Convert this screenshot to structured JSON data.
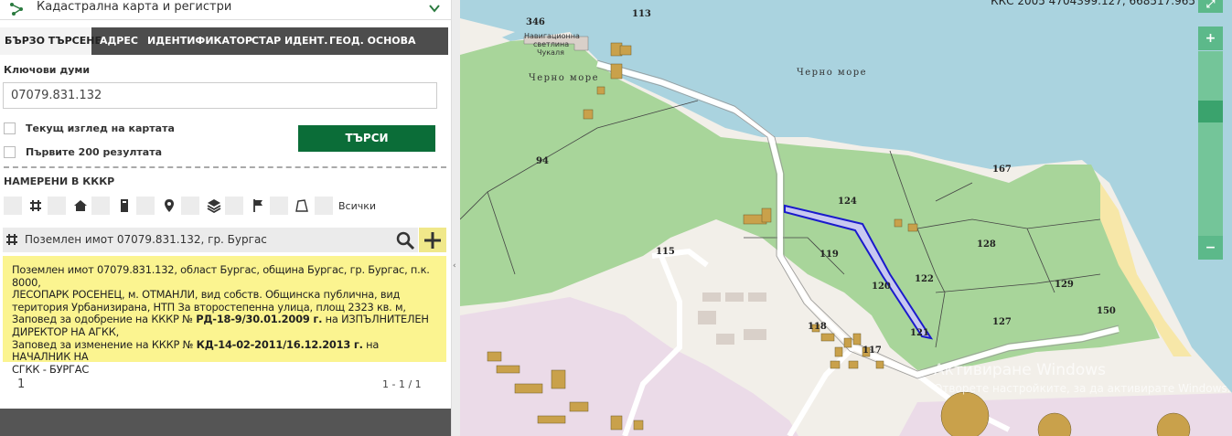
{
  "header": {
    "title": "Кадастрална карта и регистри"
  },
  "tabs": [
    "БЪРЗО ТЪРСЕНЕ",
    "АДРЕС",
    "ИДЕНТИФИКАТОР",
    "СТАР ИДЕНТ.",
    "ГЕОД. ОСНОВА"
  ],
  "search": {
    "keywords_label": "Ключови думи",
    "keywords_value": "07079.831.132",
    "current_view_label": "Текущ изглед на картата",
    "first200_label": "Първите 200 резултата",
    "search_button": "ТЪРСИ"
  },
  "found": {
    "title": "НАМЕРЕНИ В КККР",
    "all_label": "Всички",
    "filter_icons": [
      "grid-icon",
      "home-icon",
      "building-icon",
      "location-pin-icon",
      "layers-icon",
      "flag-icon",
      "polygon-icon"
    ]
  },
  "result": {
    "summary": "Поземлен имот 07079.831.132, гр. Бургас",
    "detail": {
      "line1": "Поземлен имот 07079.831.132, област Бургас, община Бургас, гр. Бургас, п.к. 8000,",
      "line2": "ЛЕСОПАРК РОСЕНЕЦ, м. ОТМАНЛИ, вид собств. Общинска публична, вид",
      "line3": "територия Урбанизирана, НТП За второстепенна улица, площ 2323 кв. м,",
      "approval_prefix": "Заповед за одобрение на КККР №",
      "approval_number": "РД-18-9/30.01.2009 г.",
      "approval_suffix": "на ИЗПЪЛНИТЕЛЕН",
      "approval_line2": "ДИРЕКТОР НА АГКК,",
      "change_prefix": "Заповед за изменение на КККР №",
      "change_number": "КД-14-02-2011/16.12.2013 г.",
      "change_suffix": "на НАЧАЛНИК НА",
      "change_line2": "СГКК - БУРГАС"
    }
  },
  "pager": {
    "page": "1",
    "range": "1 - 1 / 1"
  },
  "map": {
    "coords": "ККС 2005 4704399.127, 668517.965",
    "zoom_in": "+",
    "zoom_out": "−",
    "sea_label": "Черно море",
    "lighthouse_label_1": "Навигационна",
    "lighthouse_label_2": "светлина",
    "lighthouse_label_3": "Чукаля",
    "parcels": [
      "346",
      "113",
      "94",
      "124",
      "167",
      "115",
      "119",
      "128",
      "122",
      "120",
      "129",
      "127",
      "121",
      "118",
      "117",
      "150"
    ],
    "colors": {
      "sea": "#aad3df",
      "forest": "#a8d59a",
      "urban": "#f2efe9",
      "industrial": "#ebdbe8",
      "building": "#c9a14b",
      "highlight": "#1a1acc"
    },
    "watermark_title": "Активиране Windows",
    "watermark_sub": "Отворете настройките, за да активирате Windows."
  }
}
